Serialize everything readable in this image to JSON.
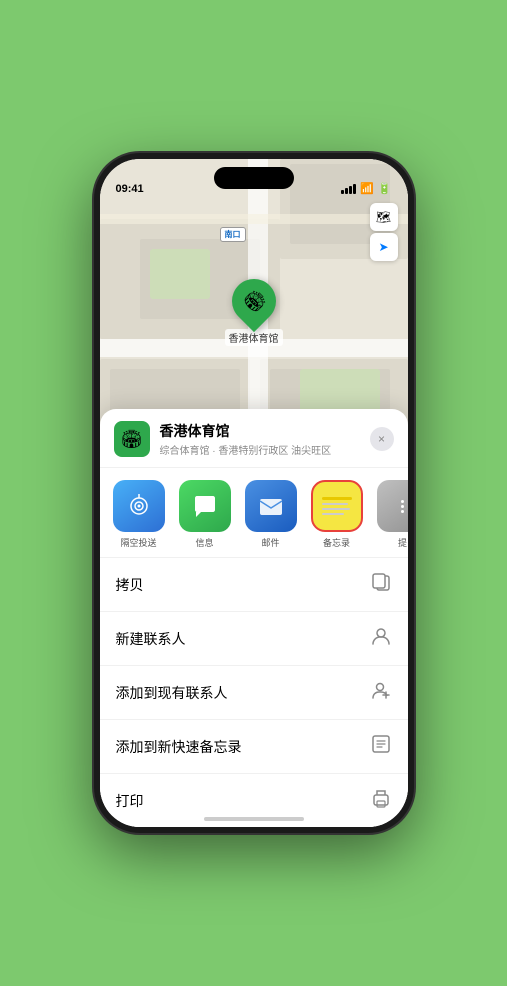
{
  "status_bar": {
    "time": "09:41",
    "signal": "signal",
    "wifi": "wifi",
    "battery": "battery"
  },
  "map": {
    "road_label": "南口",
    "map_type_btn": "🗺",
    "location_btn": "➤",
    "marker_label": "香港体育馆"
  },
  "location_card": {
    "name": "香港体育馆",
    "description": "综合体育馆 · 香港特别行政区 油尖旺区",
    "close_label": "×"
  },
  "share_row": {
    "items": [
      {
        "id": "airdrop",
        "label": "隔空投送",
        "type": "airdrop"
      },
      {
        "id": "messages",
        "label": "信息",
        "type": "messages"
      },
      {
        "id": "mail",
        "label": "邮件",
        "type": "mail"
      },
      {
        "id": "notes",
        "label": "备忘录",
        "type": "notes",
        "selected": true
      },
      {
        "id": "more",
        "label": "提",
        "type": "more"
      }
    ]
  },
  "action_items": [
    {
      "id": "copy",
      "label": "拷贝",
      "icon": "copy"
    },
    {
      "id": "new-contact",
      "label": "新建联系人",
      "icon": "person"
    },
    {
      "id": "add-existing",
      "label": "添加到现有联系人",
      "icon": "person-add"
    },
    {
      "id": "add-note",
      "label": "添加到新快速备忘录",
      "icon": "note"
    },
    {
      "id": "print",
      "label": "打印",
      "icon": "print"
    }
  ]
}
